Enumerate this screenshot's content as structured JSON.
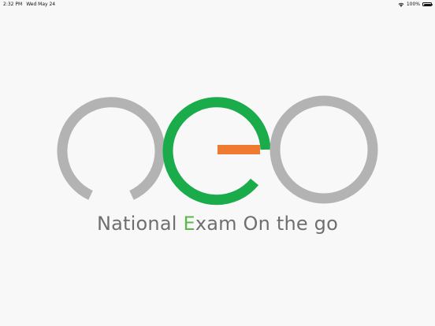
{
  "status_bar": {
    "time": "2:32 PM",
    "date": "Wed May 24",
    "battery_percent": "100%",
    "wifi_icon": "wifi-icon",
    "battery_icon": "battery-icon"
  },
  "logo": {
    "tagline_pre": "National ",
    "tagline_accent": "E",
    "tagline_post": "xam On the go",
    "colors": {
      "ring_gray": "#b3b3b3",
      "e_green": "#1aab4b",
      "e_bar_orange": "#ee7b30",
      "tagline_gray": "#6f6f6f",
      "tagline_accent": "#5cb84a"
    }
  }
}
